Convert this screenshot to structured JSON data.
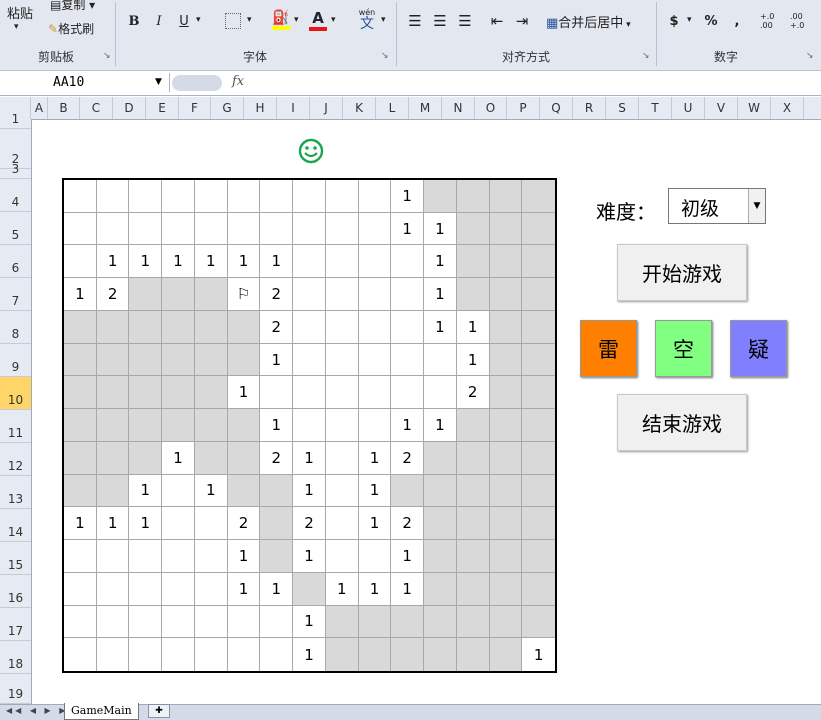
{
  "ribbon": {
    "clipboard": {
      "paste": "粘贴",
      "copy": "复制",
      "format_painter": "格式刷",
      "group": "剪贴板"
    },
    "font": {
      "bold": "B",
      "italic": "I",
      "underline": "U",
      "wen": "wén",
      "wen_char": "文",
      "font_color_glyph": "A",
      "group": "字体"
    },
    "alignment": {
      "merge_center": "合并后居中",
      "group": "对齐方式"
    },
    "number": {
      "currency": "$",
      "percent": "%",
      "comma": ",",
      "inc_dec": "+.0 .00",
      "dec_dec": ".00 +.0",
      "group": "数字"
    }
  },
  "formula_bar": {
    "name_box": "AA10",
    "fx": "fx",
    "value": ""
  },
  "columns": [
    "A",
    "B",
    "C",
    "D",
    "E",
    "F",
    "G",
    "H",
    "I",
    "J",
    "K",
    "L",
    "M",
    "N",
    "O",
    "P",
    "Q",
    "R",
    "S",
    "T",
    "U",
    "V",
    "W",
    "X"
  ],
  "rows": [
    "1",
    "2",
    "3",
    "4",
    "5",
    "6",
    "7",
    "8",
    "9",
    "10",
    "11",
    "12",
    "13",
    "14",
    "15",
    "16",
    "17",
    "18",
    "19"
  ],
  "active_row": "10",
  "game": {
    "board": [
      ". . . . . . . . . . 1 # # # #",
      ". . . . . . . . . . 1 1 # # #",
      ". 1 1 1 1 1 1 . . . . 1 # # #",
      "1 2 # # # F 2 . . . . 1 # # #",
      "# # # # # # 2 . . . . 1 1 # #",
      "# # # # # # 1 . . . . . 1 # #",
      "# # # # # 1 . . . . . . 2 # #",
      "# # # # # # 1 . . . 1 1 # # #",
      "# # # 1 # # 2 1 . 1 2 # # # #",
      "# # 1 . 1 # # 1 . 1 # # # # #",
      "1 1 1 . . 2 # 2 . 1 2 # # # #",
      ". . . . . 1 # 1 . . 1 # # # #",
      ". . . . . 1 1 # 1 1 1 # # # #",
      ". . . . . . . 1 # # # # # # #",
      ". . . . . . . 1 # # # # # # 1"
    ],
    "difficulty_label": "难度：",
    "difficulty_value": "初级",
    "start_button": "开始游戏",
    "end_button": "结束游戏",
    "mine_button": "雷",
    "empty_button": "空",
    "doubt_button": "疑"
  },
  "colors": {
    "mine": "#ff7f00",
    "empty": "#80ff80",
    "doubt": "#8080ff",
    "covered": "#d9d9d9",
    "active_row": "#ffd567"
  },
  "sheet_tab": "GameMain"
}
